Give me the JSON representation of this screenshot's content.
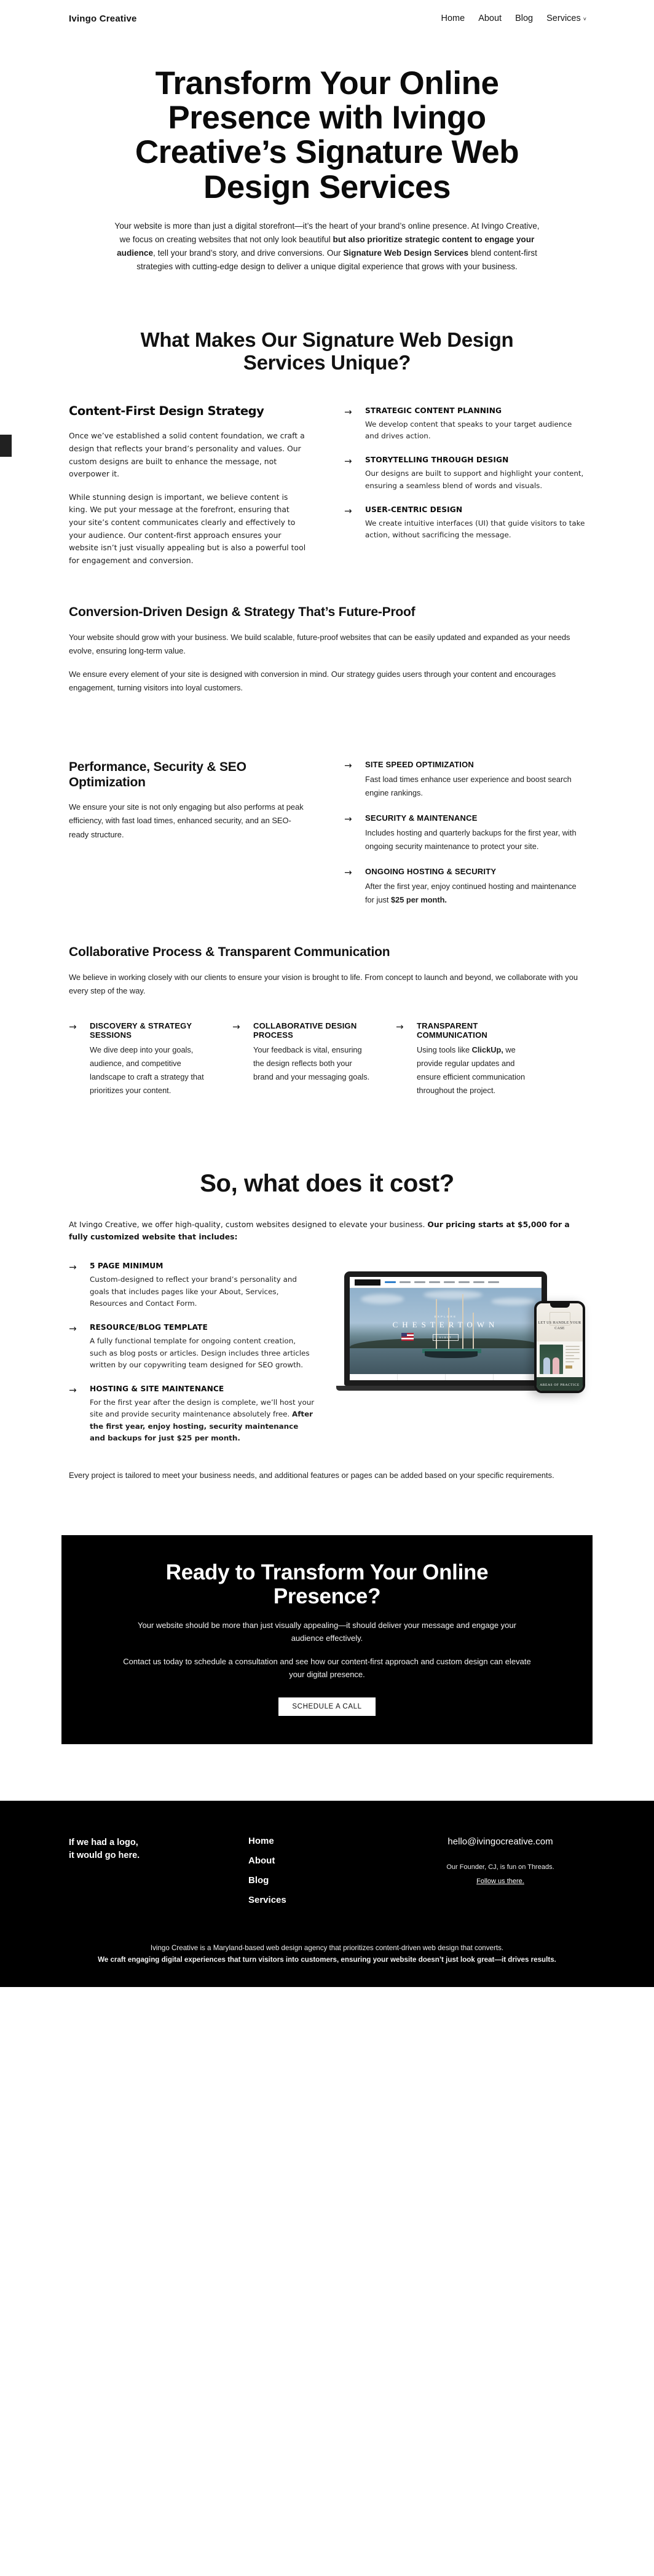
{
  "header": {
    "brand": "Ivingo Creative",
    "nav": [
      {
        "label": "Home"
      },
      {
        "label": "About"
      },
      {
        "label": "Blog"
      },
      {
        "label": "Services",
        "caret": "˅"
      }
    ]
  },
  "hero": {
    "title": "Transform Your Online Presence with Ivingo Creative’s Signature Web Design Services",
    "sub_1": "Your website is more than just a digital storefront—it’s the heart of your brand’s online presence. At Ivingo Creative, we focus on creating websites that not only look beautiful ",
    "sub_b1": "but also prioritize strategic content to engage your audience",
    "sub_2": ", tell your brand’s story, and drive conversions. Our ",
    "sub_b2": "Signature Web Design Services",
    "sub_3": " blend content-first strategies with cutting-edge design to deliver a unique digital experience that grows with your business."
  },
  "unique": {
    "title": "What Makes Our Signature Web Design Services Unique?",
    "left_heading": "Content-First Design Strategy",
    "left_p1": "Once we’ve established a solid content foundation, we craft a design that reflects your brand’s personality and values. Our custom designs are built to enhance the message, not overpower it.",
    "left_p2": "While stunning design is important, we believe content is king. We put your message at the forefront, ensuring that your site’s content communicates clearly and effectively to your audience. Our content-first approach ensures your website isn’t just visually appealing but is also a powerful tool for engagement and conversion.",
    "features": [
      {
        "arrow": "→",
        "title": "STRATEGIC CONTENT PLANNING",
        "text": "We develop content that speaks to your target audience and drives action."
      },
      {
        "arrow": "→",
        "title": "STORYTELLING THROUGH DESIGN",
        "text": "Our designs are built to support and highlight your content, ensuring a seamless blend of words and visuals."
      },
      {
        "arrow": "→",
        "title": "USER-CENTRIC DESIGN",
        "text": "We create intuitive interfaces (UI) that guide visitors to take action, without sacrificing the message."
      }
    ]
  },
  "conversion": {
    "title": "Conversion-Driven Design & Strategy That’s Future-Proof",
    "p1": "Your website should grow with your business. We build scalable, future-proof websites that can be easily updated and expanded as your needs evolve, ensuring long-term value.",
    "p2": "We ensure every element of your site is designed with conversion in mind. Our strategy guides users through your content and encourages engagement, turning visitors into loyal customers."
  },
  "performance": {
    "title": "Performance, Security & SEO Optimization",
    "body": "We ensure your site is not only engaging but also performs at peak efficiency, with fast load times, enhanced security, and an SEO-ready structure.",
    "features": [
      {
        "arrow": "→",
        "title": "SITE SPEED OPTIMIZATION",
        "text": "Fast load times enhance user experience and boost search engine rankings."
      },
      {
        "arrow": "→",
        "title": "SECURITY & MAINTENANCE",
        "text": "Includes hosting and quarterly backups for the first year, with ongoing security maintenance to protect your site."
      },
      {
        "arrow": "→",
        "title": "ONGOING HOSTING & SECURITY",
        "text_1": "After the first year, enjoy continued hosting and maintenance for just ",
        "text_bold": "$25 per month."
      }
    ]
  },
  "collaborative": {
    "title": "Collaborative Process & Transparent Communication",
    "body": "We believe in working closely with our clients to ensure your vision is brought to life. From concept to launch and beyond, we collaborate with you every step of the way.",
    "columns": [
      {
        "arrow": "→",
        "title": "DISCOVERY & STRATEGY SESSIONS",
        "text": "We dive deep into your goals, audience, and competitive landscape to craft a strategy that prioritizes your content."
      },
      {
        "arrow": "→",
        "title": "COLLABORATIVE DESIGN PROCESS",
        "text": "Your feedback is vital, ensuring the design reflects both your brand and your messaging goals."
      },
      {
        "arrow": "→",
        "title": "TRANSPARENT COMMUNICATION",
        "text_1": "Using tools like ",
        "text_bold": "ClickUp,",
        "text_2": " we provide regular updates and ensure efficient communication throughout the project."
      }
    ]
  },
  "pricing": {
    "title": "So, what does it cost?",
    "lede_1": "At Ivingo Creative, we offer high-quality, custom websites designed to elevate your business. ",
    "lede_bold": "Our pricing starts at $5,000 for a fully customized website that includes:",
    "items": [
      {
        "arrow": "→",
        "title": "5 PAGE MINIMUM",
        "text": "Custom-designed to reflect your brand’s personality and goals that includes pages like your About, Services, Resources and Contact Form."
      },
      {
        "arrow": "→",
        "title": "RESOURCE/BLOG TEMPLATE",
        "text": "A fully functional template for ongoing content creation, such as blog posts or articles. Design includes three articles written by our copywriting team designed for SEO growth."
      },
      {
        "arrow": "→",
        "title": "HOSTING & SITE MAINTENANCE",
        "text_1": "For the first year after the design is complete, we’ll host your site and provide security maintenance absolutely free. ",
        "text_bold": "After the first year, enjoy hosting, security maintenance and backups for just $25 per month."
      }
    ],
    "tail": "Every project is tailored to meet your business needs, and additional features or pages can be added based on your specific requirements.",
    "mockup": {
      "laptop_site_eyebrow": "EXPLORE",
      "laptop_site_title": "CHESTERTOWN",
      "laptop_site_button": "VISIT",
      "phone_site_title": "LET US HANDLE YOUR CASE",
      "phone_site_bar": "AREAS OF PRACTICE"
    }
  },
  "cta": {
    "title": "Ready to Transform Your Online Presence?",
    "p1": "Your website should be more than just visually appealing—it should deliver your message and engage your audience effectively.",
    "p2": "Contact us today to schedule a consultation and see how our content-first approach and custom design can elevate your digital presence.",
    "button": "SCHEDULE A CALL"
  },
  "footer": {
    "logo_placeholder": "If we had a logo,\nit would go here.",
    "logo_line1": "If we had a logo,",
    "logo_line2": "it would go here.",
    "nav": [
      {
        "label": "Home"
      },
      {
        "label": "About"
      },
      {
        "label": "Blog"
      },
      {
        "label": "Services"
      }
    ],
    "email": "hello@ivingocreative.com",
    "note": "Our Founder, CJ, is fun on Threads.",
    "follow": "Follow us there.",
    "bottom_1": "Ivingo Creative is a Maryland-based web design agency that prioritizes content-driven web design that converts.",
    "bottom_2": "We craft engaging digital experiences that turn visitors into customers, ensuring your website doesn’t just look great—it drives results."
  },
  "colors": {
    "background": "#ffffff",
    "text": "#121212",
    "inverse_bg": "#000000",
    "inverse_text": "#ffffff",
    "edge_tab": "#212121"
  }
}
